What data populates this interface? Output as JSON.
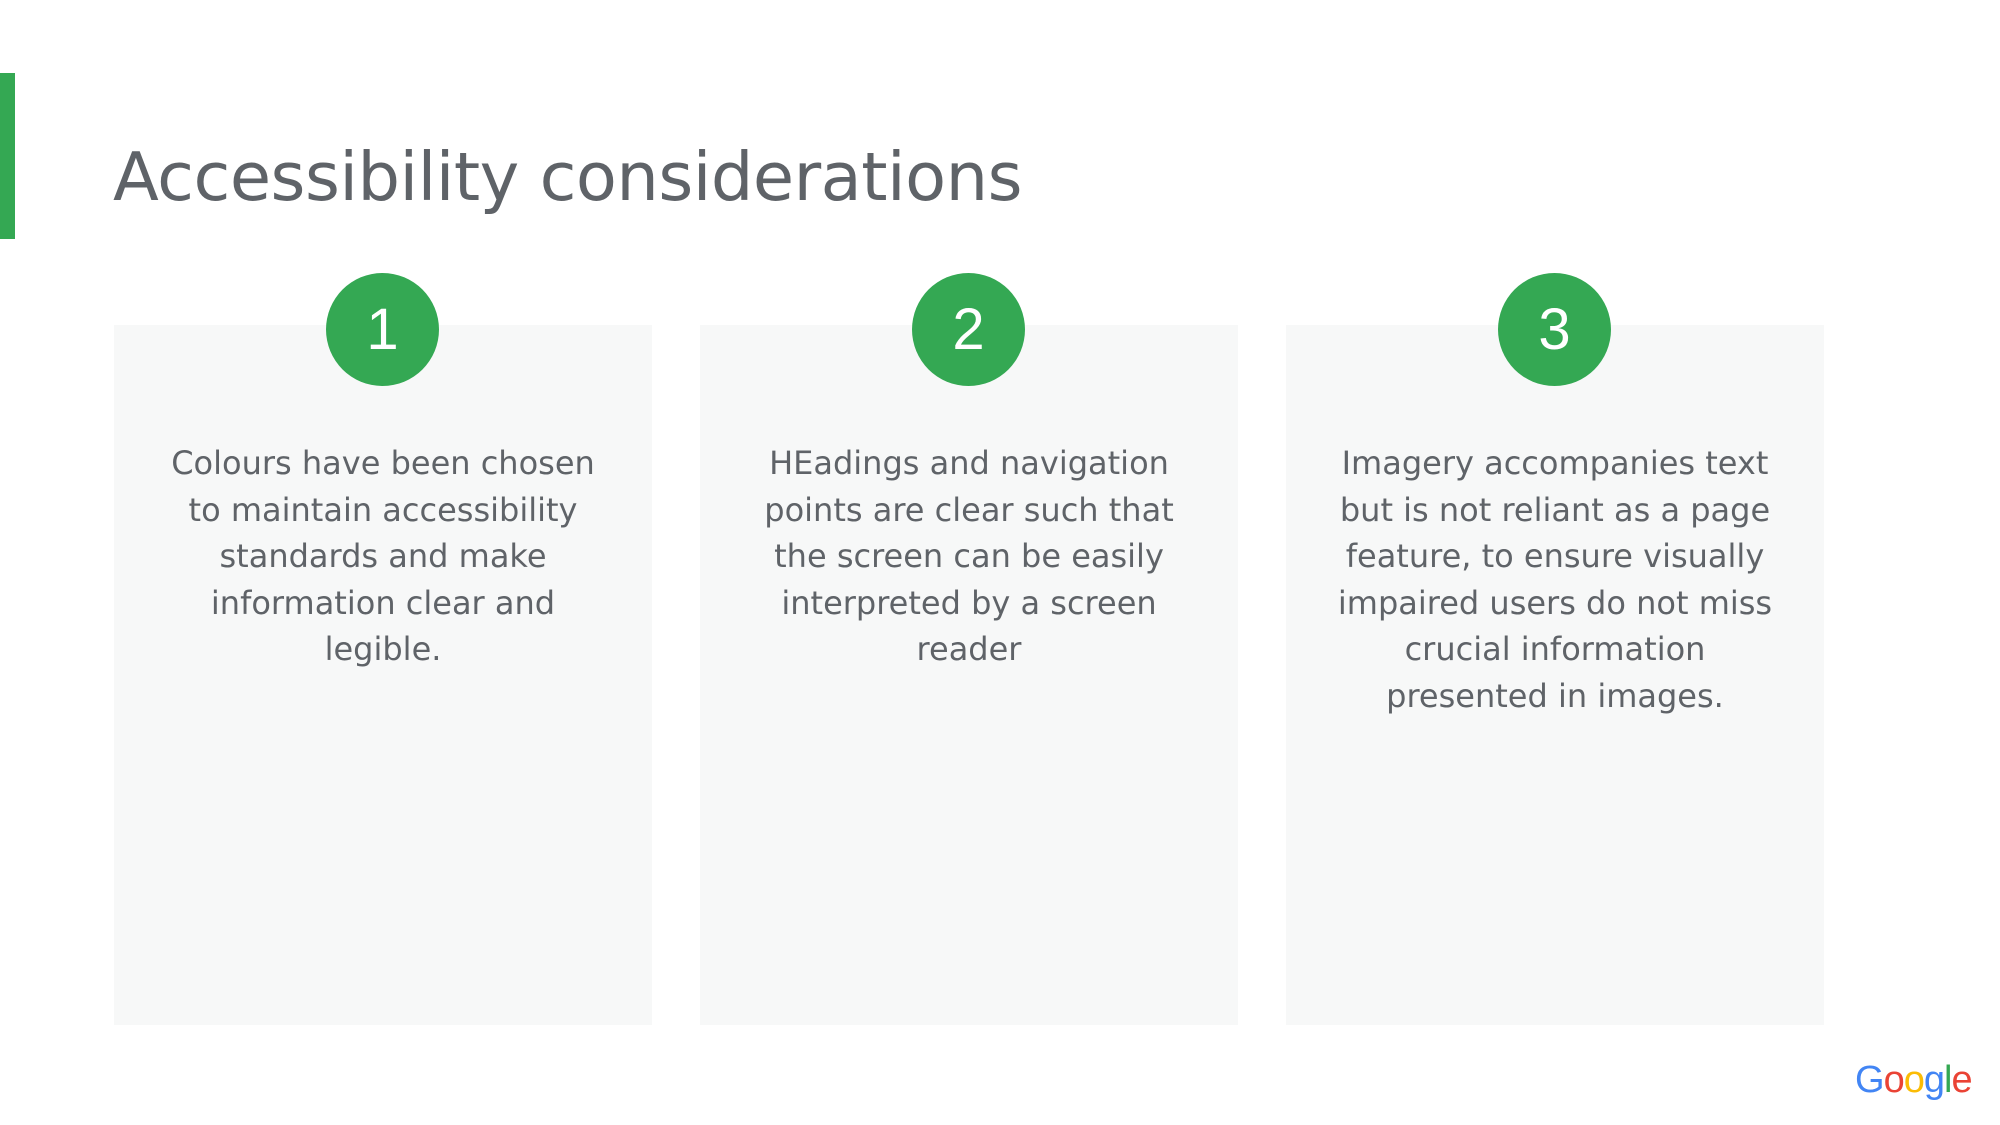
{
  "slide": {
    "title": "Accessibility considerations",
    "accent_color": "#34a853",
    "card_background": "#f7f8f8",
    "text_color": "#5f6368"
  },
  "cards": [
    {
      "number": "1",
      "text": "Colours have been chosen to maintain accessibility standards and make information clear and legible."
    },
    {
      "number": "2",
      "text": "HEadings and navigation points are clear such that the screen can be easily interpreted by a screen reader"
    },
    {
      "number": "3",
      "text": "Imagery accompanies text but is not reliant as a page feature, to ensure visually impaired users do not miss crucial information presented in images."
    }
  ],
  "logo": {
    "text": "Google",
    "letters": [
      {
        "char": "G",
        "color": "#4285f4"
      },
      {
        "char": "o",
        "color": "#ea4335"
      },
      {
        "char": "o",
        "color": "#fbbc05"
      },
      {
        "char": "g",
        "color": "#4285f4"
      },
      {
        "char": "l",
        "color": "#34a853"
      },
      {
        "char": "e",
        "color": "#ea4335"
      }
    ]
  }
}
